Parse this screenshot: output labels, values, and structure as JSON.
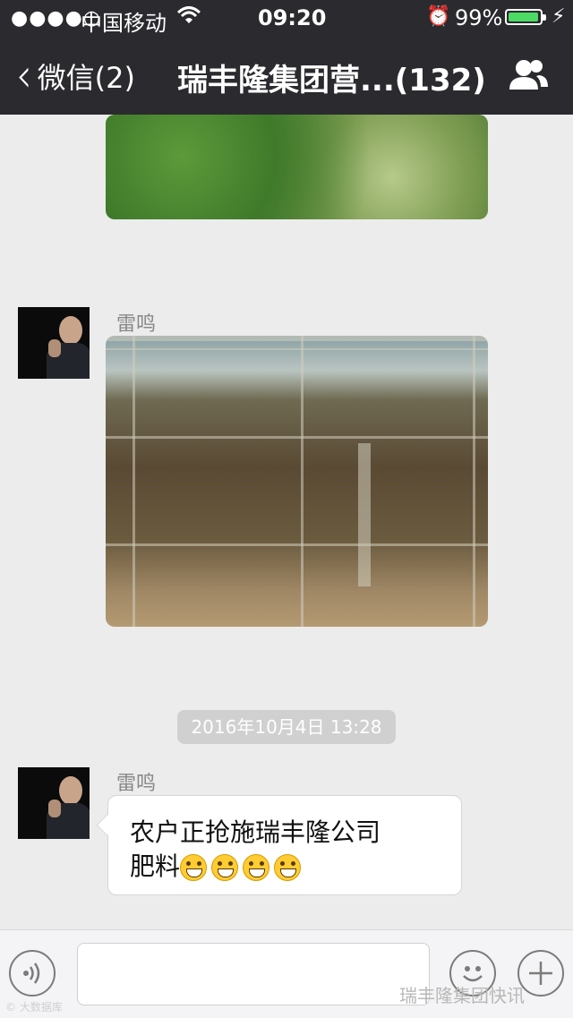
{
  "status_bar": {
    "signal": "●●●●○",
    "carrier": "中国移动",
    "time": "09:20",
    "battery_percent": "99%",
    "battery_level": 0.99,
    "battery_color": "#4cd964"
  },
  "nav": {
    "back_label": "微信(2)",
    "title": "瑞丰隆集团营...(132)",
    "right_icon": "group-members-icon"
  },
  "messages": [
    {
      "type": "image",
      "sender": "",
      "description": ""
    },
    {
      "type": "image",
      "sender": "雷鸣"
    },
    {
      "type": "timestamp",
      "text": "2016年10月4日 13:28"
    },
    {
      "type": "text",
      "sender": "雷鸣",
      "text_line1": "农户正抢施瑞丰隆公司",
      "text_line2": "肥料",
      "emoji_count": 4
    }
  ],
  "input_bar": {
    "voice_icon": "voice-icon",
    "emoji_icon": "emoji-icon",
    "more_icon": "plus-icon"
  },
  "watermarks": {
    "left": "© 大数据库",
    "right": "瑞丰隆集团快讯"
  }
}
